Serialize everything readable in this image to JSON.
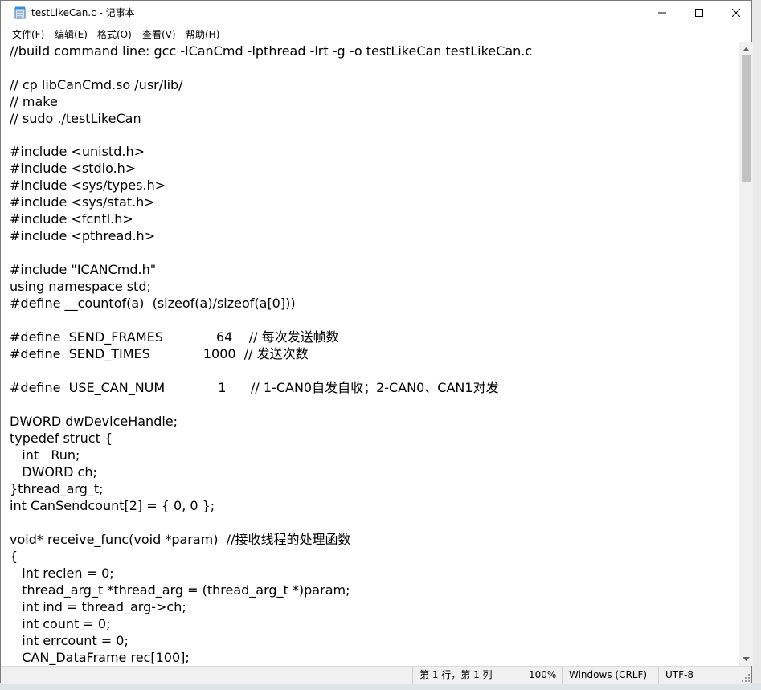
{
  "window": {
    "title": "testLikeCan.c - 记事本"
  },
  "menu": [
    "文件(F)",
    "编辑(E)",
    "格式(O)",
    "查看(V)",
    "帮助(H)"
  ],
  "code_lines": [
    "//build command line: gcc -lCanCmd -lpthread -lrt -g -o testLikeCan testLikeCan.c",
    "",
    "// cp libCanCmd.so /usr/lib/",
    "// make",
    "// sudo ./testLikeCan",
    "",
    "#include <unistd.h>",
    "#include <stdio.h>",
    "#include <sys/types.h>",
    "#include <sys/stat.h>",
    "#include <fcntl.h>",
    "#include <pthread.h>",
    "",
    "#include \"ICANCmd.h\"",
    "using namespace std;",
    "#define __countof(a)  (sizeof(a)/sizeof(a[0]))",
    "",
    "#define  SEND_FRAMES             64    // 每次发送帧数",
    "#define  SEND_TIMES             1000  // 发送次数",
    "",
    "#define  USE_CAN_NUM             1      // 1-CAN0自发自收；2-CAN0、CAN1对发",
    "",
    "DWORD dwDeviceHandle;",
    "typedef struct {",
    "   int   Run;",
    "   DWORD ch;",
    "}thread_arg_t;",
    "int CanSendcount[2] = { 0, 0 };",
    "",
    "void* receive_func(void *param)  //接收线程的处理函数",
    "{",
    "   int reclen = 0;",
    "   thread_arg_t *thread_arg = (thread_arg_t *)param;",
    "   int ind = thread_arg->ch;",
    "   int count = 0;",
    "   int errcount = 0;",
    "   CAN_DataFrame rec[100];"
  ],
  "status": {
    "position": "第 1 行，第 1 列",
    "zoom": "100%",
    "line_ending": "Windows (CRLF)",
    "encoding": "UTF-8"
  }
}
